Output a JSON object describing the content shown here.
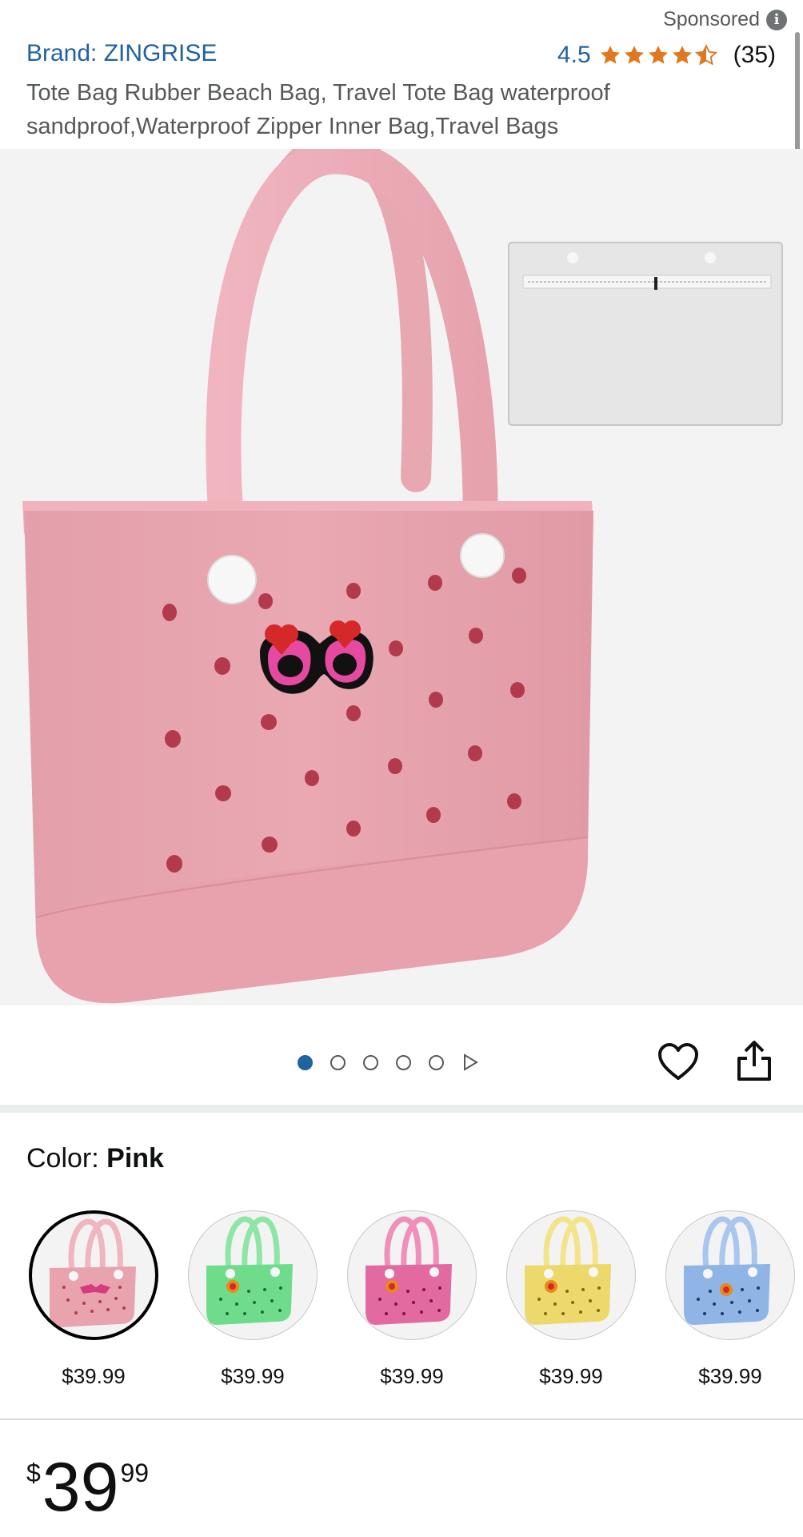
{
  "header": {
    "sponsored_label": "Sponsored",
    "info_icon": "i",
    "brand": "Brand: ZINGRISE",
    "rating_value": "4.5",
    "rating_count": "(35)",
    "rating_stars": 4.5,
    "title": "Tote Bag Rubber Beach Bag, Travel Tote Bag waterproof sandproof,Waterproof Zipper Inner Bag,Travel Bags"
  },
  "gallery": {
    "image_count": 5,
    "active_index": 0,
    "has_video": true
  },
  "actions": {
    "wishlist_icon": "heart-icon",
    "share_icon": "share-icon"
  },
  "color": {
    "label": "Color: ",
    "selected": "Pink",
    "options": [
      {
        "name": "pink",
        "price": "$39.99",
        "hex": "#e8a3ae"
      },
      {
        "name": "green",
        "price": "$39.99",
        "hex": "#6fdc8c"
      },
      {
        "name": "hot-pink",
        "price": "$39.99",
        "hex": "#e36aa0"
      },
      {
        "name": "yellow",
        "price": "$39.99",
        "hex": "#ecd86b"
      },
      {
        "name": "blue",
        "price": "$39.99",
        "hex": "#8fb4e6"
      }
    ]
  },
  "price": {
    "symbol": "$",
    "whole": "39",
    "fraction": "99"
  },
  "colors": {
    "link": "#2162a1",
    "star": "#de7921",
    "bag_pink": "#e8a3ae"
  }
}
